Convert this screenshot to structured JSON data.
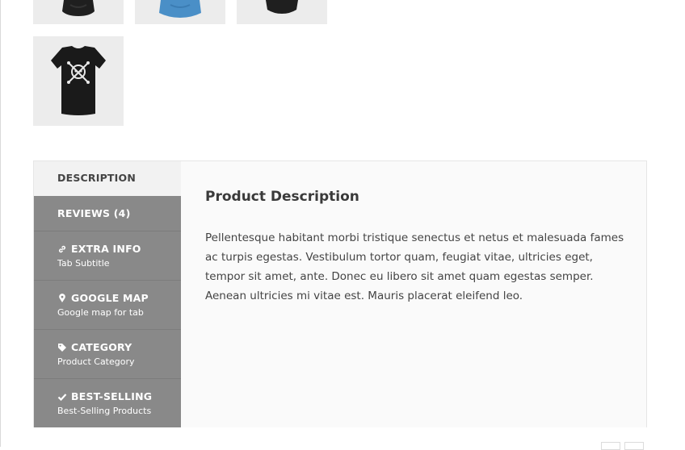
{
  "thumbnails": [
    {
      "name": "black-hoodie",
      "color": "#1f1f1f"
    },
    {
      "name": "blue-hoodie",
      "color": "#4a8fc7"
    },
    {
      "name": "black-shirt",
      "color": "#1f1f1f"
    },
    {
      "name": "black-skull-tshirt",
      "color": "#1a1a1a"
    }
  ],
  "tabs": [
    {
      "title": "DESCRIPTION",
      "subtitle": "",
      "icon": "",
      "active": true
    },
    {
      "title": "REVIEWS (4)",
      "subtitle": "",
      "icon": ""
    },
    {
      "title": "EXTRA INFO",
      "subtitle": "Tab Subtitle",
      "icon": "link-icon"
    },
    {
      "title": "GOOGLE MAP",
      "subtitle": "Google map for tab",
      "icon": "map-marker-icon"
    },
    {
      "title": "CATEGORY",
      "subtitle": "Product Category",
      "icon": "tag-icon"
    },
    {
      "title": "BEST-SELLING",
      "subtitle": "Best-Selling Products",
      "icon": "check-icon"
    }
  ],
  "panel": {
    "title": "Product Description",
    "text": "Pellentesque habitant morbi tristique senectus et netus et malesuada fames ac turpis egestas. Vestibulum tortor quam, feugiat vitae, ultricies eget, tempor sit amet, ante. Donec eu libero sit amet quam egestas semper. Aenean ultricies mi vitae est. Mauris placerat eleifend leo."
  },
  "colors": {
    "tab_bg": "#898989",
    "tab_active_bg": "#f2f2f2",
    "panel_bg": "#fafafa"
  }
}
